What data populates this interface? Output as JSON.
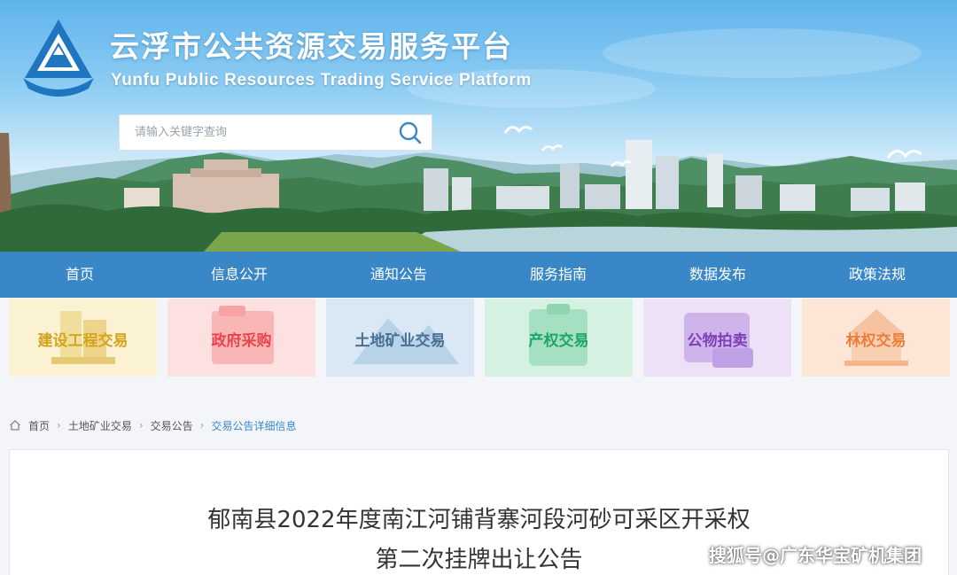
{
  "header": {
    "title": "云浮市公共资源交易服务平台",
    "subtitle": "Yunfu Public Resources Trading Service Platform",
    "logo_icon": "platform-logo-icon"
  },
  "search": {
    "placeholder": "请输入关键字查询",
    "value": "",
    "icon": "search-icon"
  },
  "nav": {
    "items": [
      {
        "label": "首页"
      },
      {
        "label": "信息公开"
      },
      {
        "label": "通知公告"
      },
      {
        "label": "服务指南"
      },
      {
        "label": "数据发布"
      },
      {
        "label": "政策法规"
      }
    ]
  },
  "categories": [
    {
      "label": "建设工程交易",
      "color": "#d3a51d",
      "bg": "#fbf1d3"
    },
    {
      "label": "政府采购",
      "color": "#e9464c",
      "bg": "#fde0e0"
    },
    {
      "label": "土地矿业交易",
      "color": "#4a6f95",
      "bg": "#d9e8f4"
    },
    {
      "label": "产权交易",
      "color": "#1fa567",
      "bg": "#d5f1e2"
    },
    {
      "label": "公物拍卖",
      "color": "#7e3fb5",
      "bg": "#ece1f7"
    },
    {
      "label": "林权交易",
      "color": "#ec7d3b",
      "bg": "#fde6d6"
    }
  ],
  "breadcrumb": {
    "home_icon": "home-icon",
    "items": [
      "首页",
      "土地矿业交易",
      "交易公告",
      "交易公告详细信息"
    ]
  },
  "announcement": {
    "title_line1": "郁南县2022年度南江河铺背寨河段河砂可采区开采权",
    "title_line2": "第二次挂牌出让公告"
  },
  "watermark": "搜狐号@广东华宝矿机集团",
  "colors": {
    "nav_bg": "#3a87c7",
    "accent": "#3a87c7"
  }
}
